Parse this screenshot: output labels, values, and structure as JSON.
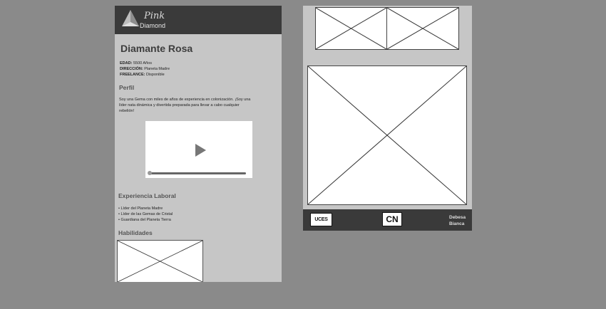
{
  "brand": {
    "logo_script": "Pink",
    "logo_name": "Diamond"
  },
  "profile": {
    "name": "Diamante Rosa",
    "info": [
      {
        "label": "EDAD:",
        "value": "5500 Años"
      },
      {
        "label": "DIRECCIÓN:",
        "value": "Planeta Madre"
      },
      {
        "label": "FREELANCE:",
        "value": "Disponible"
      }
    ],
    "section_profile": "Perfil",
    "profile_text": "Soy una Gema con miles de años de experiencia en colonización. ¡Soy una líder nata dinámica y divertida preparada para llevar a cabo cualquier rebelión!",
    "video": {
      "progress": 0.0
    },
    "section_experience": "Experiencia Laboral",
    "experience": [
      "• Líder del Planeta Madre",
      "• Líder de las Gemas de Cristal",
      "• Guardiana del Planeta Tierra"
    ],
    "section_skills": "Habilidades"
  },
  "footer": {
    "uces_logo": "UCES",
    "cn_logo": "CN",
    "author_line1": "Debesa",
    "author_line2": "Bianca"
  },
  "icons": {
    "play": "play-icon",
    "image_placeholder": "image-placeholder-icon"
  }
}
